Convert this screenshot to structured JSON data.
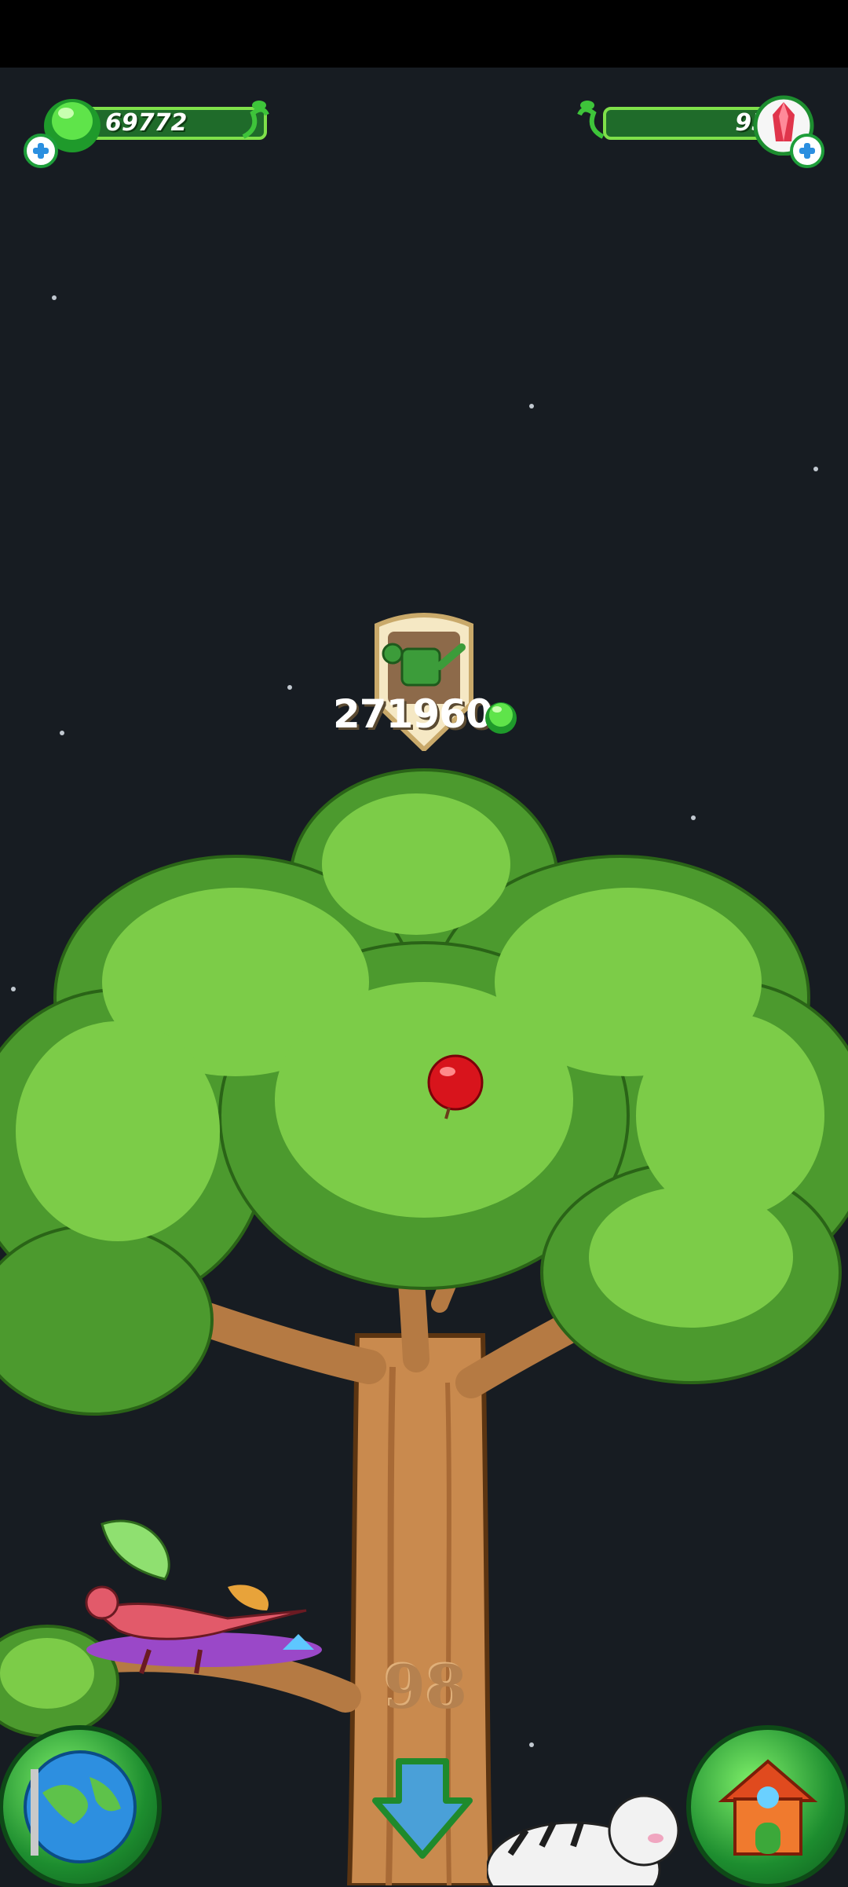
{
  "hud": {
    "left_currency": {
      "value": "69772",
      "icon": "green-gem-icon"
    },
    "right_currency": {
      "value": "95",
      "icon": "red-crystal-icon"
    }
  },
  "tree": {
    "upgrade_badge": {
      "icon": "watering-can-icon",
      "price": "271960",
      "currency_icon": "green-gem-icon"
    },
    "level_number": "98",
    "fruit_icon": "red-apple-icon"
  },
  "bottom_nav": {
    "left_button_icon": "globe-icon",
    "center_button_icon": "down-arrow-icon",
    "right_button_icon": "house-icon"
  },
  "colors": {
    "background": "#171c22",
    "accent_green": "#7fe04a",
    "trunk": "#c98a4e"
  }
}
